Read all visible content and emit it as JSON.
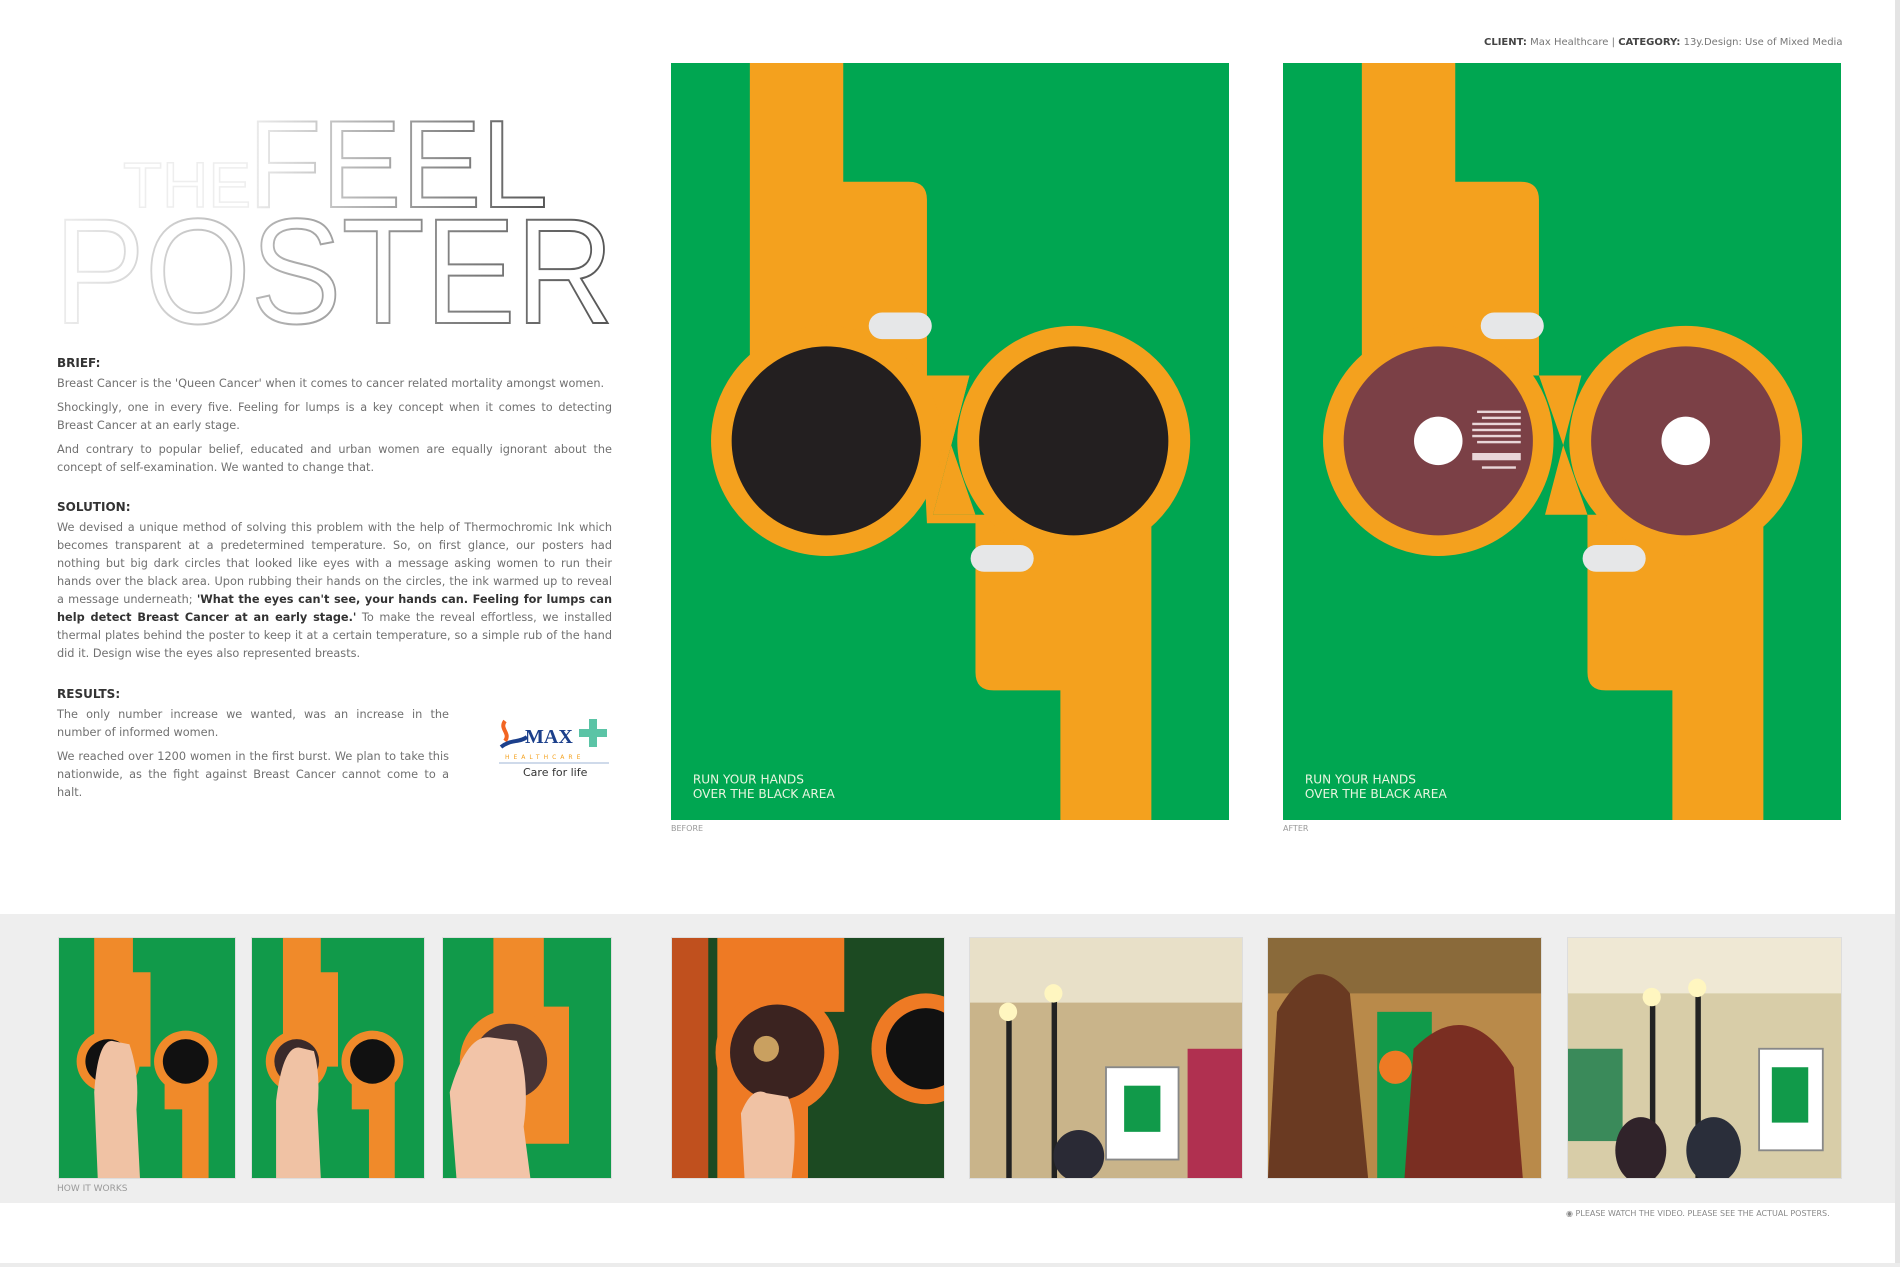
{
  "header": {
    "client_label": "CLIENT:",
    "client_value": "Max Healthcare",
    "separator": "|",
    "category_label": "CATEGORY:",
    "category_value": "13y.Design: Use of Mixed Media"
  },
  "title": {
    "line_small": "THE",
    "line1": "FEEL",
    "line2": "POSTER"
  },
  "brief": {
    "heading": "BRIEF:",
    "paragraphs": [
      "Breast Cancer is the 'Queen Cancer' when it comes to cancer related mortality amongst women.",
      "Shockingly, one in every five. Feeling for lumps is a key concept when it comes to detecting Breast Cancer at an early stage.",
      "And contrary to popular belief, educated and urban women are equally ignorant about the concept of self-examination. We wanted to change that."
    ]
  },
  "solution": {
    "heading": "SOLUTION:",
    "text_before": "We devised a unique method of solving this problem with the help of Thermochromic Ink which becomes transparent at a predetermined temperature. So, on first glance, our posters had nothing but big dark circles that looked like eyes with a message asking women to run their hands over the black area. Upon rubbing their hands on the circles, the ink warmed up to reveal a message underneath; ",
    "text_bold": "'What the eyes can't see, your hands can. Feeling for lumps can help detect Breast Cancer at an early stage.'",
    "text_after": " To make the reveal effortless, we installed thermal plates behind the poster to keep it at a certain temperature, so a simple rub of the hand did it. Design wise the eyes also represented breasts."
  },
  "results": {
    "heading": "RESULTS:",
    "paragraphs": [
      "The only number increase we wanted, was an increase in the number of informed women.",
      "We reached over 1200 women in the first burst. We plan to take this nationwide, as the fight against Breast Cancer cannot come to a halt."
    ]
  },
  "logo": {
    "brand": "MAX",
    "sub": "HEALTHCARE",
    "tagline": "Care for life"
  },
  "posters": [
    {
      "caption": "BEFORE",
      "line1": "RUN YOUR HANDS",
      "line2": "OVER THE BLACK AREA",
      "state": "before"
    },
    {
      "caption": "AFTER",
      "line1": "RUN YOUR HANDS",
      "line2": "OVER THE BLACK AREA",
      "state": "after"
    }
  ],
  "how_it_works_label": "HOW IT WORKS",
  "footer_note": "PLEASE WATCH THE VIDEO. PLEASE SEE THE ACTUAL POSTERS.",
  "colors": {
    "green": "#00A651",
    "orange": "#F4A11E",
    "black_ink": "#231F20",
    "revealed_ink": "#7B4046",
    "pill": "#E6E7E8"
  }
}
